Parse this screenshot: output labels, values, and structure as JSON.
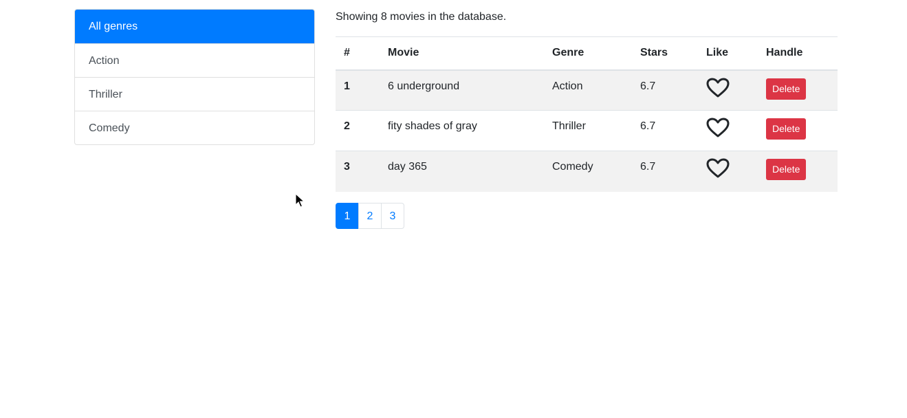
{
  "sidebar": {
    "genres": [
      "All genres",
      "Action",
      "Thriller",
      "Comedy"
    ],
    "active": "All genres"
  },
  "main": {
    "summary": "Showing 8 movies in the database.",
    "columns": [
      "#",
      "Movie",
      "Genre",
      "Stars",
      "Like",
      "Handle"
    ],
    "rows": [
      {
        "index": "1",
        "movie": "6 underground",
        "genre": "Action",
        "stars": "6.7",
        "liked": false,
        "action": "Delete"
      },
      {
        "index": "2",
        "movie": "fity shades of gray",
        "genre": "Thriller",
        "stars": "6.7",
        "liked": false,
        "action": "Delete"
      },
      {
        "index": "3",
        "movie": "day 365",
        "genre": "Comedy",
        "stars": "6.7",
        "liked": false,
        "action": "Delete"
      }
    ],
    "pagination": {
      "pages": [
        "1",
        "2",
        "3"
      ],
      "current": "1"
    }
  },
  "icons": {
    "like": "heart-outline-icon",
    "cursor": "mouse-pointer-icon"
  },
  "colors": {
    "primary": "#007bff",
    "danger": "#dc3545",
    "stripe": "#f2f2f2"
  }
}
